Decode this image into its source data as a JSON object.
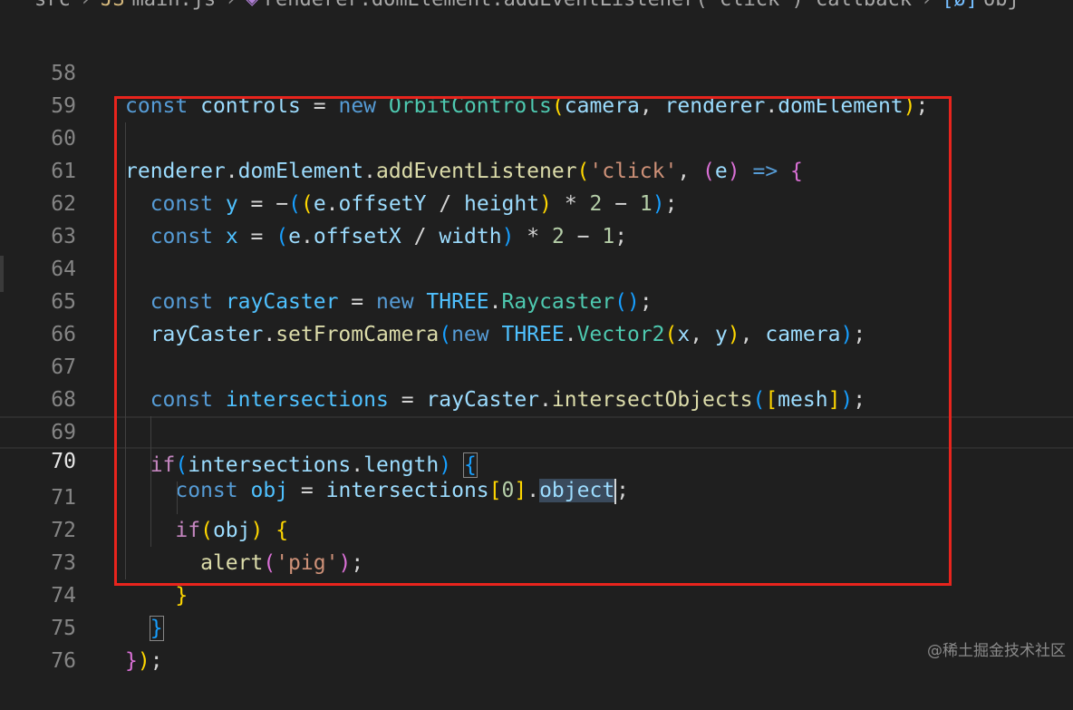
{
  "breadcrumb": {
    "folder": "src",
    "file": "main.js",
    "symbol": "renderer.domElement.addEventListener('click') callback",
    "item": "obj"
  },
  "lines": [
    {
      "n": "58"
    },
    {
      "n": "59"
    },
    {
      "n": "60"
    },
    {
      "n": "61"
    },
    {
      "n": "62"
    },
    {
      "n": "63"
    },
    {
      "n": "64"
    },
    {
      "n": "65"
    },
    {
      "n": "66"
    },
    {
      "n": "67"
    },
    {
      "n": "68"
    },
    {
      "n": "69"
    },
    {
      "n": "70"
    },
    {
      "n": "71"
    },
    {
      "n": "72"
    },
    {
      "n": "73"
    },
    {
      "n": "74"
    },
    {
      "n": "75"
    },
    {
      "n": "76"
    }
  ],
  "code": {
    "kw_const": "const",
    "kw_new": "new",
    "kw_if": "if",
    "controls": "controls",
    "OrbitControls": "OrbitControls",
    "camera": "camera",
    "renderer": "renderer",
    "domElement": "domElement",
    "addEventListener": "addEventListener",
    "click_str": "'click'",
    "e": "e",
    "arrow": "=>",
    "y": "y",
    "x": "x",
    "offsetY": "offsetY",
    "offsetX": "offsetX",
    "height": "height",
    "width": "width",
    "two": "2",
    "one": "1",
    "zero": "0",
    "rayCaster": "rayCaster",
    "THREE": "THREE",
    "Raycaster": "Raycaster",
    "setFromCamera": "setFromCamera",
    "Vector2": "Vector2",
    "intersections": "intersections",
    "intersectObjects": "intersectObjects",
    "mesh": "mesh",
    "length": "length",
    "obj": "obj",
    "object": "object",
    "alert": "alert",
    "pig_str": "'pig'"
  },
  "watermark": "@稀土掘金技术社区",
  "colors": {
    "highlight_box": "#e8241d",
    "background": "#1f1f1f"
  }
}
